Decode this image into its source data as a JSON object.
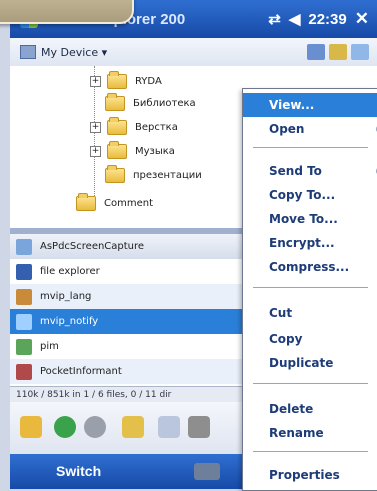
{
  "titlebar": {
    "app_title": "Resco Explorer 200",
    "clock": "22:39",
    "close_glyph": "✕",
    "signal_glyph": "⇄",
    "sound_glyph": "◀"
  },
  "toolbar": {
    "location": "My Device ▾"
  },
  "tree": {
    "items": [
      {
        "label": "RYDA"
      },
      {
        "label": "Библиотека"
      },
      {
        "label": "Верстка"
      },
      {
        "label": "Музыка"
      },
      {
        "label": "презентации"
      },
      {
        "label": "Comment"
      }
    ]
  },
  "list": {
    "header": "AsPdcScreenCapture",
    "items": [
      {
        "label": "file explorer"
      },
      {
        "label": "mvip_lang"
      },
      {
        "label": "mvip_notify"
      },
      {
        "label": "pim"
      },
      {
        "label": "PocketInformant"
      }
    ]
  },
  "status": {
    "text": "110k / 851k in 1 / 6 files, 0 / 11 dir"
  },
  "softkeys": {
    "left": "Switch"
  },
  "context_menu": {
    "items": [
      {
        "label": "View...",
        "highlighted": true
      },
      {
        "label": "Open"
      },
      {
        "label": "Send To"
      },
      {
        "label": "Copy To..."
      },
      {
        "label": "Move To..."
      },
      {
        "label": "Encrypt..."
      },
      {
        "label": "Compress..."
      },
      {
        "label": "Cut"
      },
      {
        "label": "Copy"
      },
      {
        "label": "Duplicate"
      },
      {
        "label": "Delete"
      },
      {
        "label": "Rename"
      },
      {
        "label": "Properties"
      }
    ]
  },
  "colors": {
    "title_blue": "#1f5cc0",
    "selection": "#2a7fd9",
    "menu_text": "#1d3c78"
  }
}
